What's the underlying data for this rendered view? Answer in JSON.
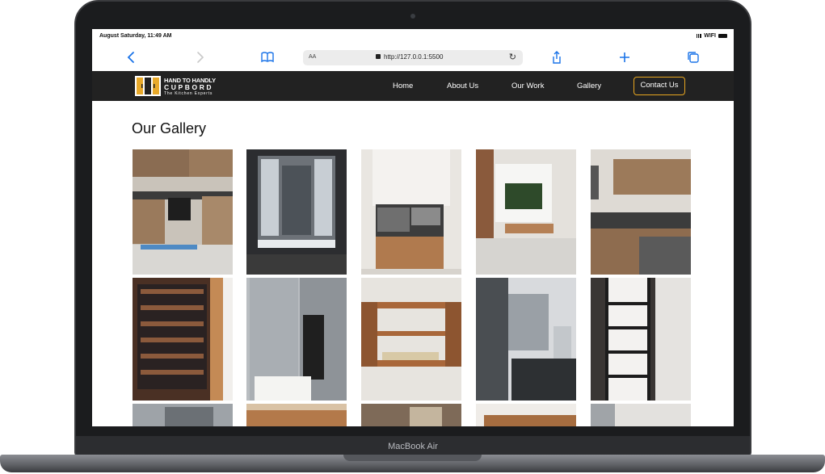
{
  "status_bar": {
    "time": "August Saturday, 11:49 AM",
    "wifi_label": "WIFI"
  },
  "browser": {
    "text_size_label": "AA",
    "url": "http://127.0.0.1:5500",
    "icons": [
      "back-icon",
      "forward-icon",
      "bookmarks-icon",
      "lock-icon",
      "reload-icon",
      "share-icon",
      "new-tab-icon",
      "tabs-icon"
    ]
  },
  "site": {
    "logo": {
      "line1": "HAND TO HANDLY",
      "line2": "CUPBORD",
      "line3": "The Kitchen Experts"
    },
    "nav": [
      "Home",
      "About Us",
      "Our Work",
      "Gallery"
    ],
    "cta": "Contact Us",
    "accent": "#e6a520",
    "nav_bg": "#222222"
  },
  "gallery": {
    "heading": "Our Gallery",
    "rows": [
      [
        "kitchen-corner",
        "glass-cabinet",
        "oven-tower",
        "tv-unit",
        "wood-kitchen"
      ],
      [
        "wine-wall",
        "grey-pantry",
        "wood-shelves",
        "wall-bracket",
        "shelf-frame"
      ],
      [
        "partial-1",
        "partial-2",
        "partial-3",
        "partial-4",
        "partial-5"
      ]
    ]
  },
  "device": {
    "label": "MacBook Air"
  }
}
